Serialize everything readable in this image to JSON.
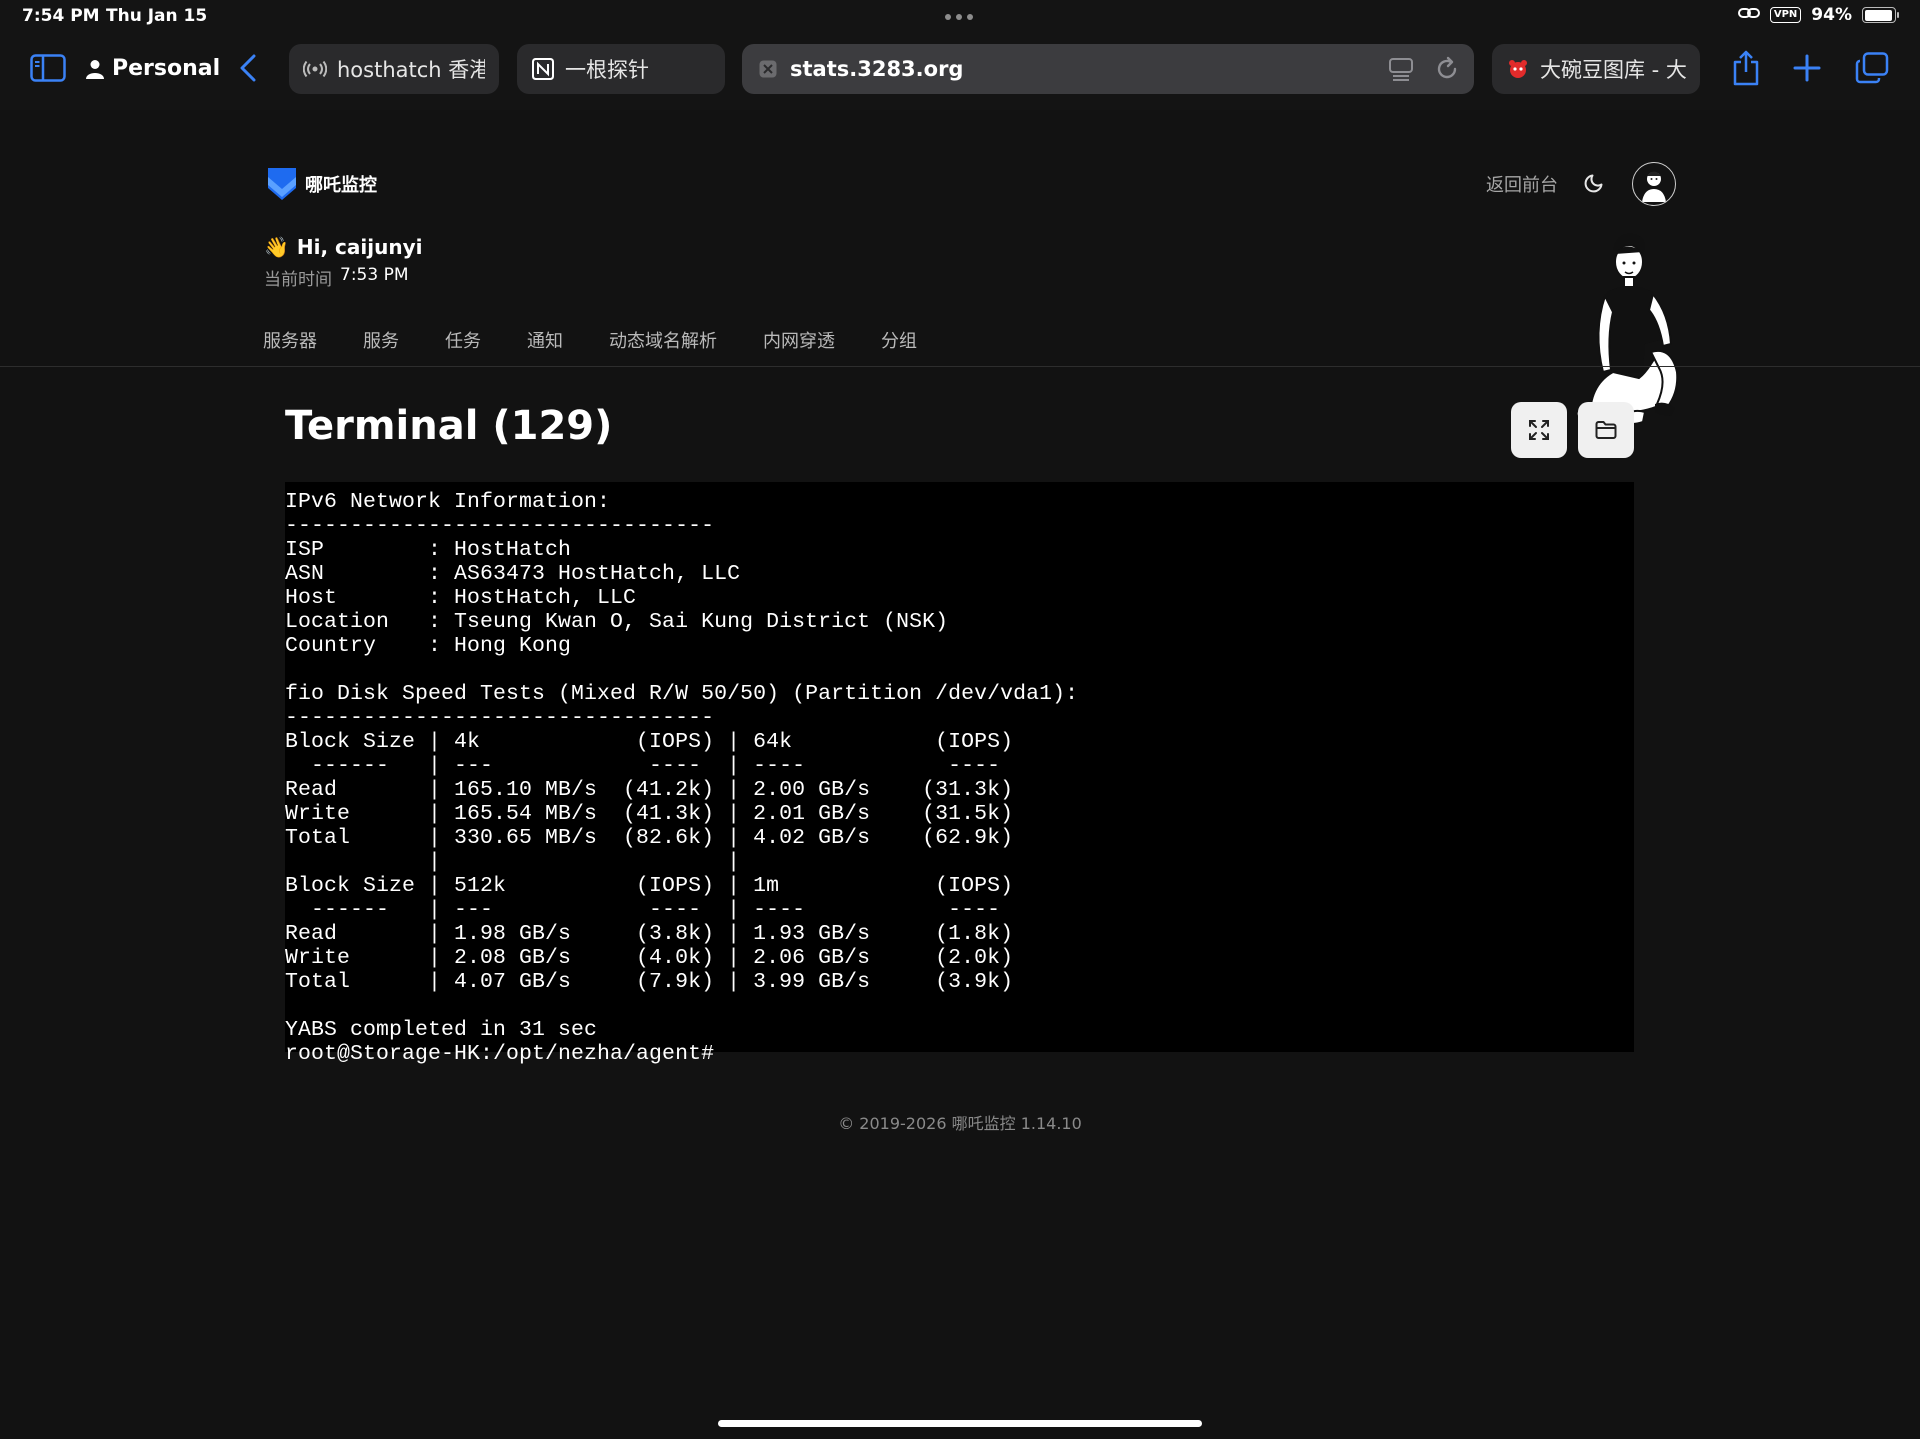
{
  "status_bar": {
    "time": "7:54 PM",
    "date": "Thu Jan 15",
    "vpn": "VPN",
    "battery": "94%",
    "battery_level": 0.94
  },
  "browser": {
    "profile": "Personal",
    "tabs": [
      {
        "label": "hosthatch 香港",
        "icon": "broadcast-icon"
      },
      {
        "label": "一根探针",
        "icon": "notion-icon"
      },
      {
        "label": "大碗豆图库 - 大碗",
        "icon": "red-mascot-icon"
      }
    ],
    "address": "stats.3283.org"
  },
  "app": {
    "logo_text": "哪吒监控",
    "back_link": "返回前台",
    "greeting_emoji": "👋",
    "greeting": "Hi, caijunyi",
    "clock_label": "当前时间",
    "clock_value": "7:53 PM",
    "nav": [
      "服务器",
      "服务",
      "任务",
      "通知",
      "动态域名解析",
      "内网穿透",
      "分组"
    ],
    "accent": "#1E6BF0"
  },
  "terminal": {
    "title": "Terminal (129)",
    "lines": [
      "IPv6 Network Information:",
      "---------------------------------",
      "ISP        : HostHatch",
      "ASN        : AS63473 HostHatch, LLC",
      "Host       : HostHatch, LLC",
      "Location   : Tseung Kwan O, Sai Kung District (NSK)",
      "Country    : Hong Kong",
      "",
      "fio Disk Speed Tests (Mixed R/W 50/50) (Partition /dev/vda1):",
      "---------------------------------",
      "Block Size | 4k            (IOPS) | 64k           (IOPS)",
      "  ------   | ---            ----  | ----           ----",
      "Read       | 165.10 MB/s  (41.2k) | 2.00 GB/s    (31.3k)",
      "Write      | 165.54 MB/s  (41.3k) | 2.01 GB/s    (31.5k)",
      "Total      | 330.65 MB/s  (82.6k) | 4.02 GB/s    (62.9k)",
      "           |                      |",
      "Block Size | 512k          (IOPS) | 1m            (IOPS)",
      "  ------   | ---            ----  | ----           ----",
      "Read       | 1.98 GB/s     (3.8k) | 1.93 GB/s     (1.8k)",
      "Write      | 2.08 GB/s     (4.0k) | 2.06 GB/s     (2.0k)",
      "Total      | 4.07 GB/s     (7.9k) | 3.99 GB/s     (3.9k)",
      "",
      "YABS completed in 31 sec",
      "root@Storage-HK:/opt/nezha/agent#"
    ]
  },
  "footer": "© 2019-2026 哪吒监控 1.14.10"
}
